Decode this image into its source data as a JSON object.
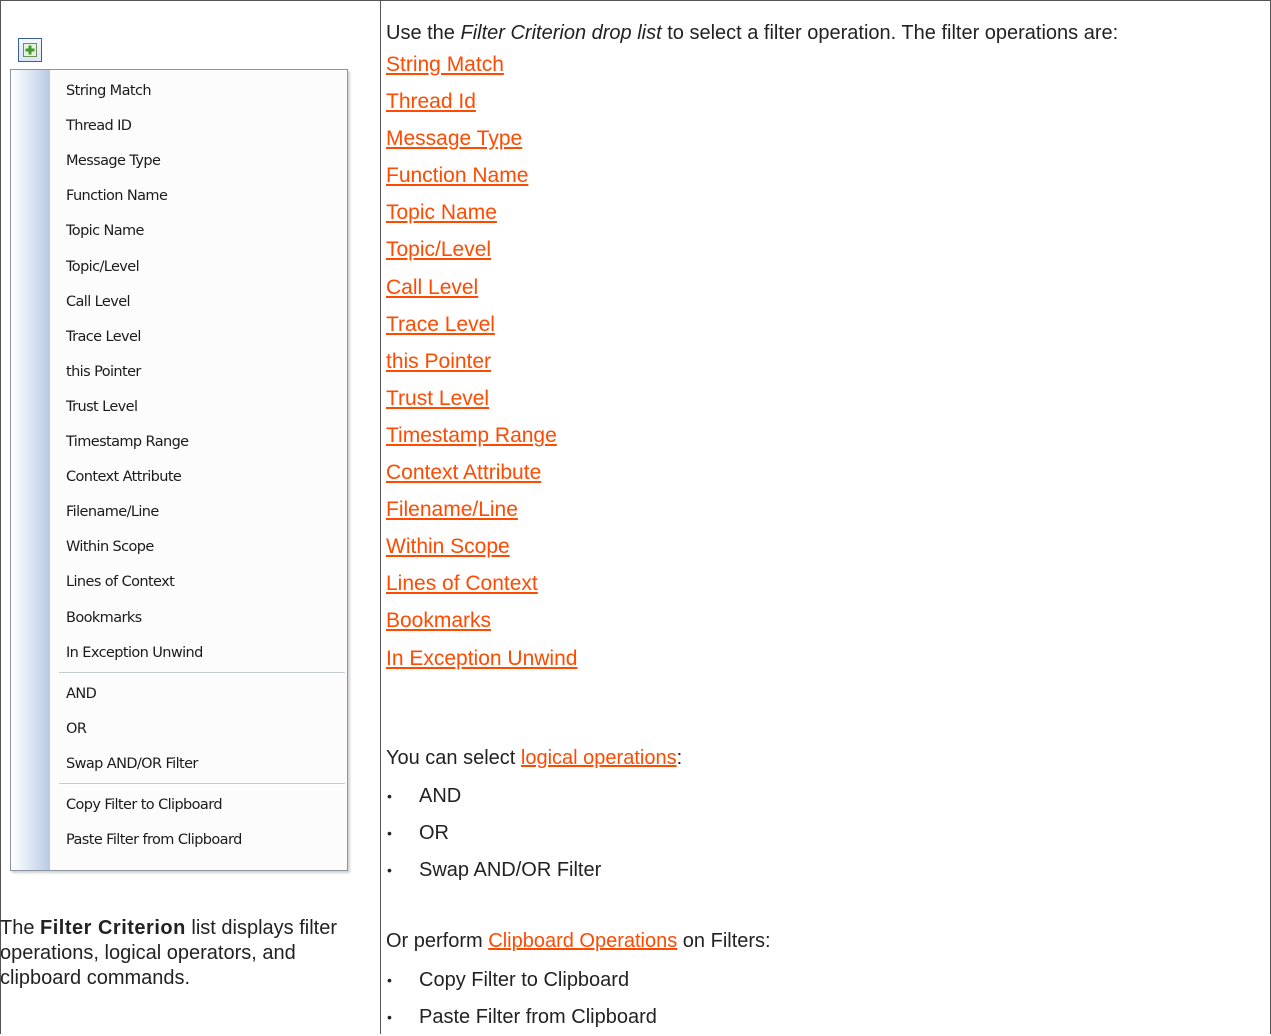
{
  "left_panel": {
    "menu_items": [
      "String Match",
      "Thread ID",
      "Message Type",
      "Function Name",
      "Topic Name",
      "Topic/Level",
      "Call Level",
      "Trace Level",
      "this Pointer",
      "Trust Level",
      "Timestamp Range",
      "Context Attribute",
      "Filename/Line",
      "Within Scope",
      "Lines of Context",
      "Bookmarks",
      "In Exception Unwind"
    ],
    "logical_items": [
      "AND",
      "OR",
      "Swap AND/OR Filter"
    ],
    "clipboard_items": [
      "Copy Filter to Clipboard",
      "Paste Filter from Clipboard"
    ],
    "caption": {
      "prefix": "The ",
      "bold": "Filter Criterion",
      "suffix": " list displays filter operations, logical operators, and clipboard commands."
    }
  },
  "right_panel": {
    "intro_before": "Use the ",
    "intro_italic": "Filter Criterion drop list",
    "intro_after": " to select a filter operation. The filter operations are:",
    "filter_links": [
      "String Match",
      "Thread Id",
      "Message Type",
      "Function Name",
      "Topic Name",
      "Topic/Level",
      "Call Level",
      "Trace Level",
      "this Pointer",
      "Trust Level",
      "Timestamp Range",
      "Context Attribute",
      "Filename/Line",
      "Within Scope",
      "Lines of Context",
      "Bookmarks",
      "In Exception Unwind"
    ],
    "logical": {
      "before": "You can select ",
      "link": "logical operations",
      "after": ":",
      "bullets": [
        "AND",
        "OR",
        "Swap AND/OR Filter"
      ]
    },
    "clipboard": {
      "before": "Or perform ",
      "link": "Clipboard Operations",
      "after": " on Filters:",
      "bullets": [
        "Copy Filter to Clipboard",
        "Paste Filter from Clipboard"
      ]
    },
    "bullet_glyph": "•"
  },
  "colors": {
    "link": "#ff4a00",
    "text": "#222222",
    "border": "#555555"
  }
}
